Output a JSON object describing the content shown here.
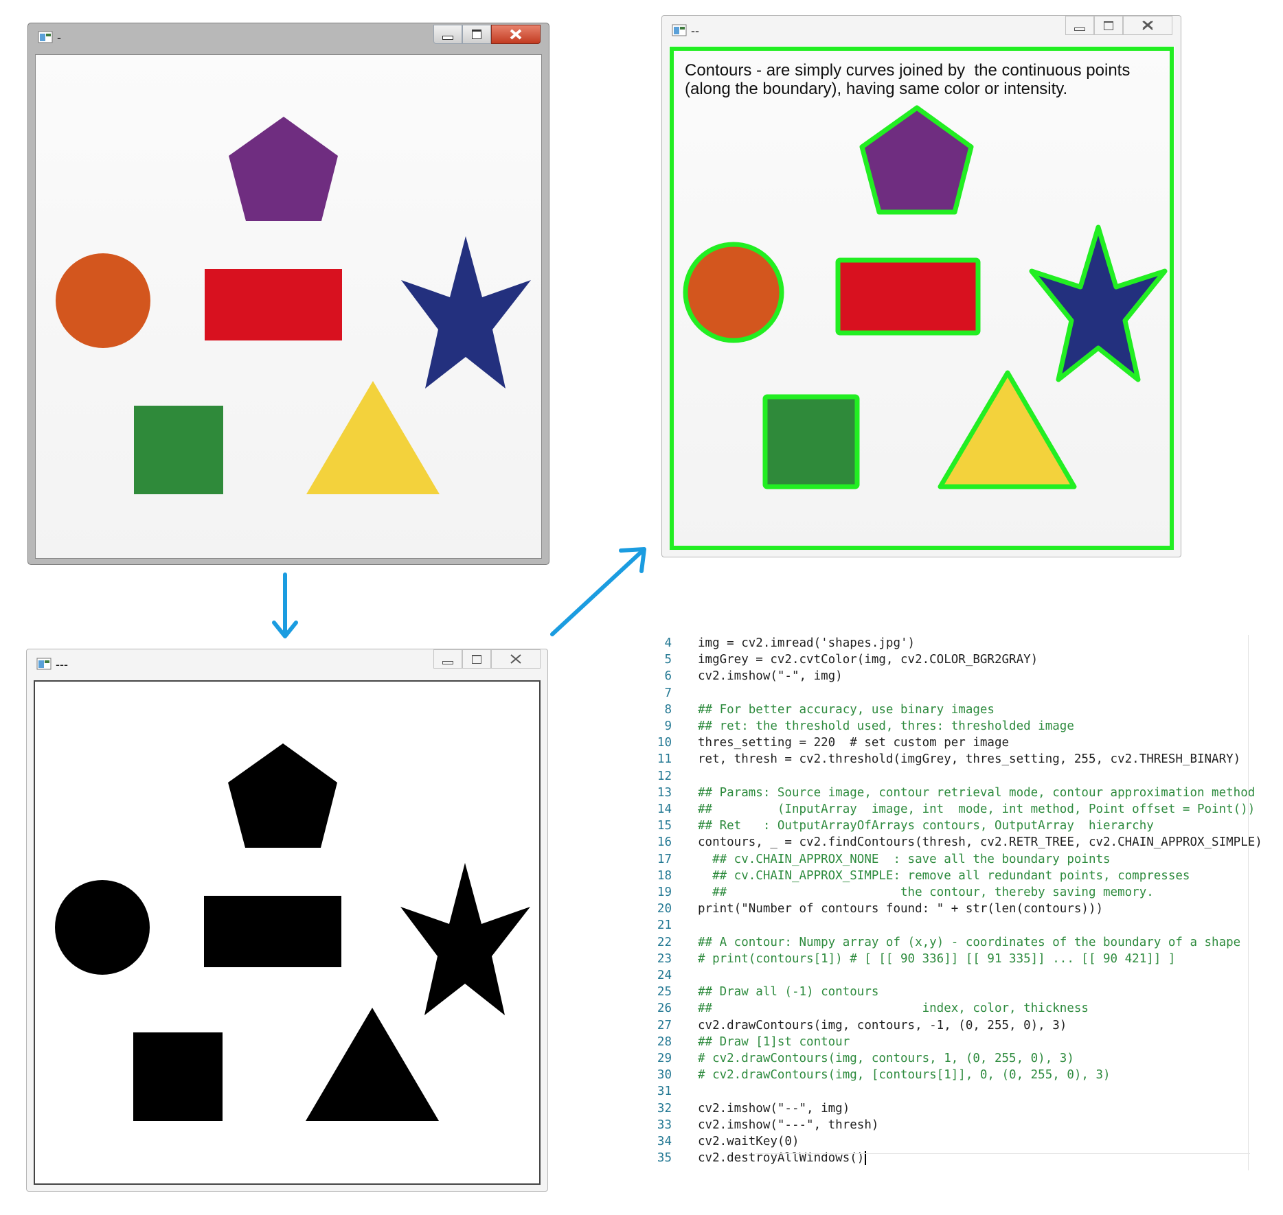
{
  "window1": {
    "title": "-"
  },
  "window2": {
    "title": "--",
    "caption_line1": "Contours - are simply curves joined by  the continuous points",
    "caption_line2": "(along the boundary), having same color or intensity."
  },
  "window3": {
    "title": "---"
  },
  "colors": {
    "pentagon": "#6f2d80",
    "circle": "#d3561e",
    "rectangle": "#d8111f",
    "star": "#23307e",
    "square": "#2f8a3a",
    "triangle": "#f3d23c",
    "contour": "#22ee22",
    "arrow": "#1b9ce0"
  },
  "icons": [
    "app-window-icon",
    "minimize-icon",
    "maximize-icon",
    "close-icon",
    "arrow-down-icon",
    "arrow-up-right-icon"
  ],
  "code": [
    {
      "n": "4",
      "t": "img = cv2.imread('shapes.jpg')"
    },
    {
      "n": "5",
      "t": "imgGrey = cv2.cvtColor(img, cv2.COLOR_BGR2GRAY)"
    },
    {
      "n": "6",
      "t": "cv2.imshow(\"-\", img)"
    },
    {
      "n": "7",
      "t": ""
    },
    {
      "n": "8",
      "t": "## For better accuracy, use binary images"
    },
    {
      "n": "9",
      "t": "## ret: the threshold used, thres: thresholded image"
    },
    {
      "n": "10",
      "t": "thres_setting = 220  # set custom per image"
    },
    {
      "n": "11",
      "t": "ret, thresh = cv2.threshold(imgGrey, thres_setting, 255, cv2.THRESH_BINARY)"
    },
    {
      "n": "12",
      "t": ""
    },
    {
      "n": "13",
      "t": "## Params: Source image, contour retrieval mode, contour approximation method"
    },
    {
      "n": "14",
      "t": "##         (InputArray  image, int  mode, int method, Point offset = Point())"
    },
    {
      "n": "15",
      "t": "## Ret   : OutputArrayOfArrays contours, OutputArray  hierarchy"
    },
    {
      "n": "16",
      "t": "contours, _ = cv2.findContours(thresh, cv2.RETR_TREE, cv2.CHAIN_APPROX_SIMPLE)"
    },
    {
      "n": "17",
      "t": "  ## cv.CHAIN_APPROX_NONE  : save all the boundary points"
    },
    {
      "n": "18",
      "t": "  ## cv.CHAIN_APPROX_SIMPLE: remove all redundant points, compresses"
    },
    {
      "n": "19",
      "t": "  ##                        the contour, thereby saving memory."
    },
    {
      "n": "20",
      "t": "print(\"Number of contours found: \" + str(len(contours)))"
    },
    {
      "n": "21",
      "t": ""
    },
    {
      "n": "22",
      "t": "## A contour: Numpy array of (x,y) - coordinates of the boundary of a shape"
    },
    {
      "n": "23",
      "t": "# print(contours[1]) # [ [[ 90 336]] [[ 91 335]] ... [[ 90 421]] ]"
    },
    {
      "n": "24",
      "t": ""
    },
    {
      "n": "25",
      "t": "## Draw all (-1) contours"
    },
    {
      "n": "26",
      "t": "##                             index, color, thickness"
    },
    {
      "n": "27",
      "t": "cv2.drawContours(img, contours, -1, (0, 255, 0), 3)"
    },
    {
      "n": "28",
      "t": "## Draw [1]st contour"
    },
    {
      "n": "29",
      "t": "# cv2.drawContours(img, contours, 1, (0, 255, 0), 3)"
    },
    {
      "n": "30",
      "t": "# cv2.drawContours(img, [contours[1]], 0, (0, 255, 0), 3)"
    },
    {
      "n": "31",
      "t": ""
    },
    {
      "n": "32",
      "t": "cv2.imshow(\"--\", img)"
    },
    {
      "n": "33",
      "t": "cv2.imshow(\"---\", thresh)"
    },
    {
      "n": "34",
      "t": "cv2.waitKey(0)"
    },
    {
      "n": "35",
      "t": "cv2.destroyAllWindows()"
    }
  ]
}
